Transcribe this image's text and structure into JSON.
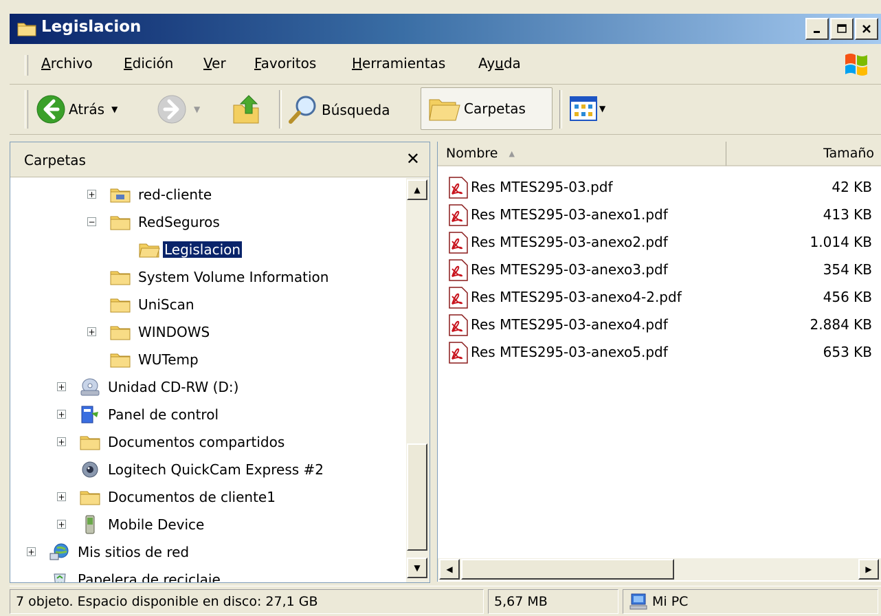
{
  "window": {
    "title": "Legislacion"
  },
  "menu": {
    "items": [
      {
        "pre": "",
        "ul": "A",
        "post": "rchivo"
      },
      {
        "pre": "",
        "ul": "E",
        "post": "dición"
      },
      {
        "pre": "",
        "ul": "V",
        "post": "er"
      },
      {
        "pre": "",
        "ul": "F",
        "post": "avoritos"
      },
      {
        "pre": "",
        "ul": "H",
        "post": "erramientas"
      },
      {
        "pre": "Ay",
        "ul": "u",
        "post": "da"
      }
    ]
  },
  "toolbar": {
    "back_label": "Atrás",
    "search_label": "Búsqueda",
    "folders_label": "Carpetas"
  },
  "folder_pane": {
    "title": "Carpetas",
    "tree": [
      {
        "label": "red-cliente"
      },
      {
        "label": "RedSeguros"
      },
      {
        "label": "Legislacion"
      },
      {
        "label": "System Volume Information"
      },
      {
        "label": "UniScan"
      },
      {
        "label": "WINDOWS"
      },
      {
        "label": "WUTemp"
      },
      {
        "label": "Unidad CD-RW (D:)"
      },
      {
        "label": "Panel de control"
      },
      {
        "label": "Documentos compartidos"
      },
      {
        "label": "Logitech QuickCam Express #2"
      },
      {
        "label": "Documentos de cliente1"
      },
      {
        "label": "Mobile Device"
      },
      {
        "label": "Mis sitios de red"
      },
      {
        "label": "Papelera de reciclaje"
      }
    ]
  },
  "file_pane": {
    "columns": {
      "name": "Nombre",
      "size": "Tamaño"
    },
    "files": [
      {
        "name": "Res MTES295-03.pdf",
        "size": "42 KB"
      },
      {
        "name": "Res MTES295-03-anexo1.pdf",
        "size": "413 KB"
      },
      {
        "name": "Res MTES295-03-anexo2.pdf",
        "size": "1.014 KB"
      },
      {
        "name": "Res MTES295-03-anexo3.pdf",
        "size": "354 KB"
      },
      {
        "name": "Res MTES295-03-anexo4-2.pdf",
        "size": "456 KB"
      },
      {
        "name": "Res MTES295-03-anexo4.pdf",
        "size": "2.884 KB"
      },
      {
        "name": "Res MTES295-03-anexo5.pdf",
        "size": "653 KB"
      }
    ]
  },
  "status": {
    "objects": "7 objeto. Espacio disponible en disco:  27,1 GB",
    "size": "5,67 MB",
    "location": "Mi PC"
  },
  "colors": {
    "title_bar": "#0a246a",
    "selection": "#0a246a",
    "chrome": "#ece9d8"
  }
}
